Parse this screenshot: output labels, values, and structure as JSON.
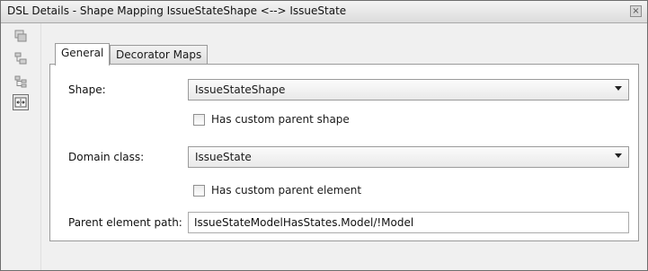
{
  "window": {
    "title": "DSL Details - Shape Mapping IssueStateShape <--> IssueState",
    "close_glyph": "×"
  },
  "left_toolbar": {
    "buttons": [
      {
        "icon": "properties-icon",
        "active": false
      },
      {
        "icon": "hierarchy-icon",
        "active": false
      },
      {
        "icon": "tree-icon",
        "active": false
      },
      {
        "icon": "shape-mapping-icon",
        "active": true
      }
    ]
  },
  "tabs": [
    {
      "label": "General",
      "selected": true
    },
    {
      "label": "Decorator Maps",
      "selected": false
    }
  ],
  "form": {
    "shape_label": "Shape:",
    "shape_value": "IssueStateShape",
    "custom_parent_shape_label": "Has custom parent shape",
    "custom_parent_shape_checked": false,
    "domain_class_label": "Domain class:",
    "domain_class_value": "IssueState",
    "custom_parent_element_label": "Has custom parent element",
    "custom_parent_element_checked": false,
    "parent_path_label": "Parent element path:",
    "parent_path_value": "IssueStateModelHasStates.Model/!Model"
  }
}
